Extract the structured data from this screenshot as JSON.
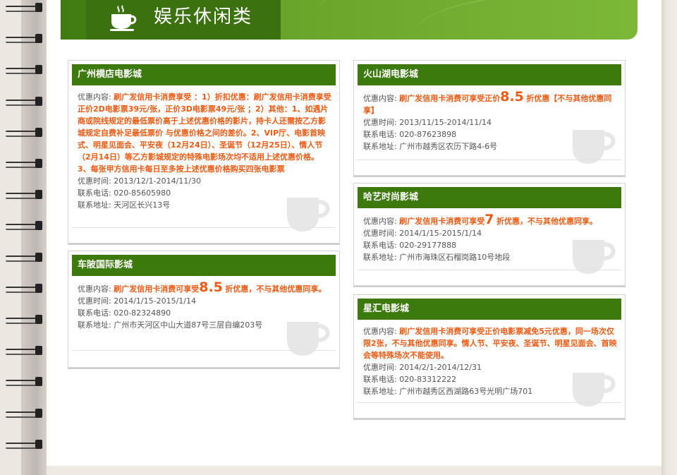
{
  "section": {
    "title": "娱乐休闲类",
    "icon": "coffee-cup-icon",
    "accent_color": "#3c7a0d",
    "promo_color": "#ef5a12"
  },
  "labels": {
    "offer": "优惠内容:",
    "time": "优惠时间:",
    "phone": "联系电话:",
    "address": "联系地址:"
  },
  "cards": [
    {
      "name": "广州横店电影城",
      "offer_text": "刷广发信用卡消费享受 ：1）折扣优惠：刷广发信用卡消费享受正价2D电影票39元/张，正价3D电影票49元/张 ；2）其他：1、如遇片商或院线规定的最低票价高于上述优惠价格的影片，持卡人还需按乙方影城规定自费补足最低票价 与优惠价格之间的差价。2、VIP厅、电影首映式、明星见面会、平安夜（12月24日）、圣诞节（12月25日）、情人节（2月14日）等乙方影城规定的特殊电影场次均不适用上述优惠价格。 3、每张甲方信用卡每日至多按上述优惠价格购买四张电影票",
      "time": "2013/12/1-2014/11/30",
      "phone": "020-85605980",
      "address": "天河区长兴13号"
    },
    {
      "name": "车陂国际影城",
      "offer_pre": "刷广发信用卡消费可享受",
      "offer_big": "8.5",
      "offer_post": "折优惠，不与其他优惠同享。",
      "time": "2014/1/15-2015/1/14",
      "phone": "020-82324890",
      "address": "广州市天河区中山大道87号三层自编203号"
    },
    {
      "name": "火山湖电影城",
      "offer_pre": "刷广发信用卡消费可享受正价",
      "offer_big": "8.5",
      "offer_post": "折优惠【不与其他优惠同享】",
      "time": "2013/11/15-2014/11/14",
      "phone": "020-87623898",
      "address": "广州市越秀区农历下路4-6号"
    },
    {
      "name": "哈艺时尚影城",
      "offer_pre": "刷广发信用卡消费可享受",
      "offer_big": "7",
      "offer_post": "折优惠，不与其他优惠同享。",
      "time": "2014/1/15-2015/1/14",
      "phone": "020-29177888",
      "address": "广州市海珠区石榴岗路10号地段"
    },
    {
      "name": "星汇电影城",
      "offer_text": "刷广发信用卡消费可享受正价电影票减免5元优惠，同一场次仅限2张，不与其他优惠同享。情人节、平安夜、圣诞节、明星见面会、首映会等特殊场次不能使用。",
      "time": "2014/2/1-2014/12/31",
      "phone": "020-83312222",
      "address": "广州市越秀区西湖路63号光明广场701"
    }
  ]
}
